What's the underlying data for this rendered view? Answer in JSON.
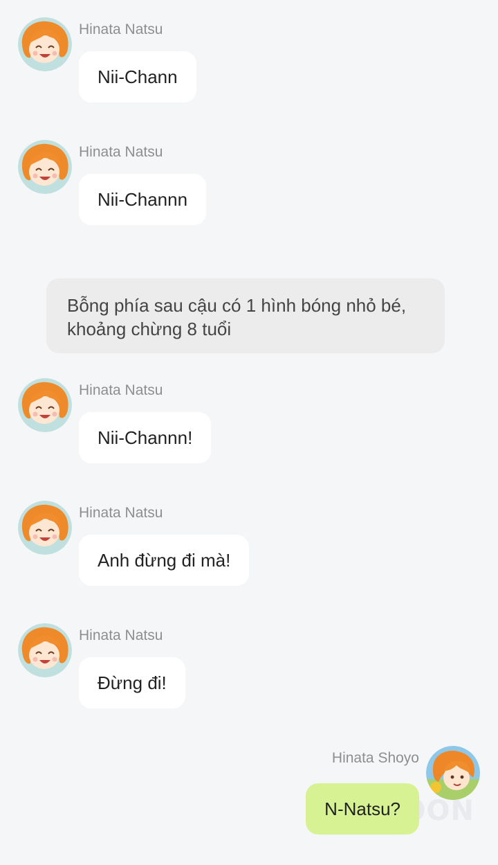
{
  "messages": [
    {
      "sender": "Hinata Natsu",
      "text": "Nii-Chann"
    },
    {
      "sender": "Hinata Natsu",
      "text": "Nii-Channn"
    },
    {
      "sender": "Hinata Natsu",
      "text": "Nii-Channn!"
    },
    {
      "sender": "Hinata Natsu",
      "text": "Anh đừng đi mà!"
    },
    {
      "sender": "Hinata Natsu",
      "text": "Đừng đi!"
    }
  ],
  "narration": "Bỗng phía sau cậu có 1 hình bóng nhỏ bé, khoảng chừng 8 tuổi",
  "reply": {
    "sender": "Hinata Shoyo",
    "text": "N-Natsu?"
  },
  "watermark": "OON",
  "colors": {
    "background": "#f5f6f8",
    "bubble": "#ffffff",
    "reply_bubble": "#d6f293",
    "narration_bubble": "#ececec",
    "sender_text": "#8e8e8e"
  },
  "icons": {
    "natsu_avatar": "avatar-natsu-icon",
    "shoyo_avatar": "avatar-shoyo-icon"
  }
}
